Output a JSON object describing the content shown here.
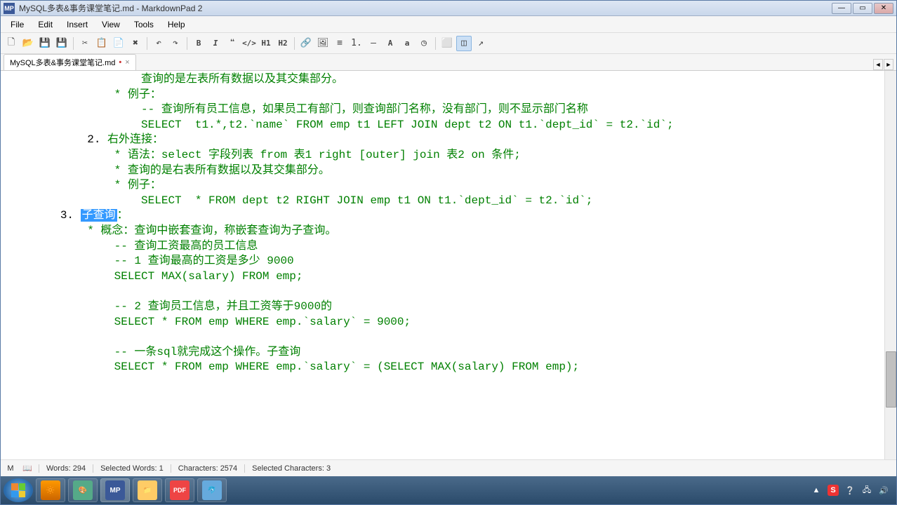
{
  "title": "MySQL多表&事务课堂笔记.md - MarkdownPad 2",
  "app_icon": "MP",
  "menus": {
    "file": "File",
    "edit": "Edit",
    "insert": "Insert",
    "view": "View",
    "tools": "Tools",
    "help": "Help"
  },
  "toolbar": {
    "h1": "H1",
    "h2": "H2",
    "bold": "B",
    "italic": "I",
    "code": "</>",
    "quote": "❝",
    "ul": "≡",
    "ol": "1.",
    "link": "🔗",
    "image": "🖼",
    "hr": "—",
    "a_upper": "A",
    "a_lower": "a",
    "time": "◷",
    "arrow": "↗"
  },
  "tab": {
    "name": "MySQL多表&事务课堂笔记.md",
    "dirty": "•",
    "close": "×"
  },
  "content": {
    "l0": "                    查询的是左表所有数据以及其交集部分。",
    "l1": "                * 例子：",
    "l2": "                    -- 查询所有员工信息，如果员工有部门，则查询部门名称，没有部门，则不显示部门名称",
    "l3": "                    SELECT  t1.*,t2.`name` FROM emp t1 LEFT JOIN dept t2 ON t1.`dept_id` = t2.`id`;",
    "l4_num": "            2. ",
    "l4_text": "右外连接：",
    "l5": "                * 语法：select 字段列表 from 表1 right [outer] join 表2 on 条件;",
    "l6": "                * 查询的是右表所有数据以及其交集部分。",
    "l7": "                * 例子：",
    "l8": "                    SELECT  * FROM dept t2 RIGHT JOIN emp t1 ON t1.`dept_id` = t2.`id`;",
    "l9_num": "        3. ",
    "l9_hl": "子查询",
    "l9_tail": "：",
    "l10": "            * 概念：查询中嵌套查询，称嵌套查询为子查询。",
    "l11": "                -- 查询工资最高的员工信息",
    "l12": "                -- 1 查询最高的工资是多少 9000",
    "l13": "                SELECT MAX(salary) FROM emp;",
    "l14": "                ",
    "l15": "                -- 2 查询员工信息，并且工资等于9000的",
    "l16": "                SELECT * FROM emp WHERE emp.`salary` = 9000;",
    "l17": "                ",
    "l18": "                -- 一条sql就完成这个操作。子查询",
    "l19": "                SELECT * FROM emp WHERE emp.`salary` = (SELECT MAX(salary) FROM emp);"
  },
  "status": {
    "words_label": "Words:",
    "words": "294",
    "sel_words_label": "Selected Words:",
    "sel_words": "1",
    "chars_label": "Characters:",
    "chars": "2574",
    "sel_chars_label": "Selected Characters:",
    "sel_chars": "3"
  },
  "taskbar": {
    "items": [
      "",
      "🎨",
      "MP",
      "📁",
      "PDF",
      "🐬"
    ]
  },
  "tray": {
    "ime": "S"
  }
}
